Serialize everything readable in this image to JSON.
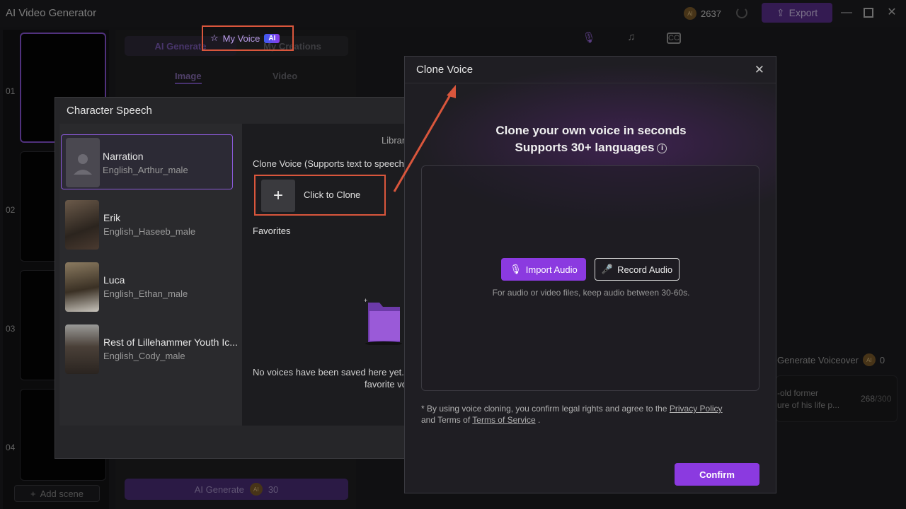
{
  "app": {
    "title": "AI Video Generator",
    "credits": "2637",
    "export_label": "Export",
    "accent": "#8b3ae0"
  },
  "scenes": {
    "numbers": [
      "01",
      "02",
      "03",
      "04"
    ],
    "add_scene_label": "Add scene"
  },
  "middle": {
    "tabs": [
      "AI Generate",
      "My Creations"
    ],
    "subtabs": [
      "Image",
      "Video"
    ],
    "ai_generate_label": "AI Generate",
    "ai_generate_cost": "30"
  },
  "right": {
    "generate_voiceover_label": "Generate Voiceover",
    "voiceover_cost": "0",
    "script_text_line1": "-old former",
    "script_text_line2": "ure of his life p...",
    "char_count": "268",
    "char_max": "/300"
  },
  "character_speech": {
    "title": "Character Speech",
    "characters": [
      {
        "name": "Narration",
        "voice": "English_Arthur_male"
      },
      {
        "name": "Erik",
        "voice": "English_Haseeb_male"
      },
      {
        "name": "Luca",
        "voice": "English_Ethan_male"
      },
      {
        "name": "Rest of Lillehammer Youth Ic...",
        "voice": "English_Cody_male"
      }
    ],
    "my_voice_tab": "My Voice",
    "ai_badge": "AI",
    "library_tab": "Librar",
    "clone_voice_label": "Clone Voice (Supports text to speech",
    "click_to_clone": "Click to Clone",
    "favorites_label": "Favorites",
    "no_voices_line1": "No voices have been saved here yet.",
    "no_voices_line2": "favorite vo"
  },
  "clone_voice": {
    "title": "Clone Voice",
    "heading1": "Clone your own voice in seconds",
    "heading2": "Supports 30+ languages",
    "import_audio": "Import Audio",
    "record_audio": "Record Audio",
    "hint": "For audio or video files, keep audio between 30-60s.",
    "legal_prefix": "* By using voice cloning, you confirm legal rights and agree to the",
    "privacy_policy": "Privacy Policy",
    "legal_and": "and Terms of",
    "terms_of_service": "Terms of Service",
    "legal_end": ".",
    "confirm_label": "Confirm"
  }
}
